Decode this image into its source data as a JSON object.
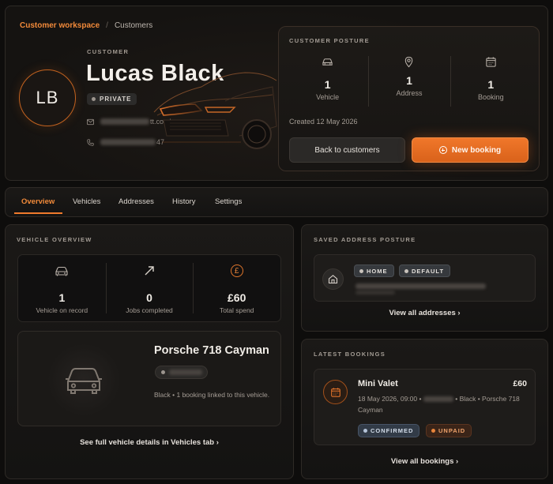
{
  "breadcrumb": {
    "workspace": "Customer workspace",
    "separator": "/",
    "current": "Customers"
  },
  "customer": {
    "section_label": "CUSTOMER",
    "initials": "LB",
    "name": "Lucas Black",
    "privacy_badge": "PRIVATE",
    "email_suffix": "tt.co.uk",
    "phone_suffix": "47"
  },
  "posture": {
    "title": "CUSTOMER POSTURE",
    "stats": [
      {
        "icon": "car-icon",
        "value": "1",
        "label": "Vehicle"
      },
      {
        "icon": "location-pin-icon",
        "value": "1",
        "label": "Address"
      },
      {
        "icon": "calendar-icon",
        "value": "1",
        "label": "Booking"
      }
    ],
    "created": "Created 12 May 2026",
    "back_button": "Back to customers",
    "new_booking_button": "New booking"
  },
  "tabs": [
    "Overview",
    "Vehicles",
    "Addresses",
    "History",
    "Settings"
  ],
  "active_tab": "Overview",
  "vehicle_overview": {
    "title": "VEHICLE OVERVIEW",
    "stats": [
      {
        "icon": "car-icon",
        "value": "1",
        "label": "Vehicle on record"
      },
      {
        "icon": "arrow-up-right-icon",
        "value": "0",
        "label": "Jobs completed"
      },
      {
        "icon": "pound-icon",
        "value": "£60",
        "label": "Total spend"
      }
    ],
    "vehicle": {
      "name": "Porsche 718 Cayman",
      "description": "Black • 1 booking linked to this vehicle."
    },
    "link": "See full vehicle details in Vehicles tab ›"
  },
  "saved_address": {
    "title": "SAVED ADDRESS POSTURE",
    "tags": [
      "HOME",
      "DEFAULT"
    ],
    "link": "View all addresses ›"
  },
  "latest_bookings": {
    "title": "LATEST BOOKINGS",
    "booking": {
      "service": "Mini Valet",
      "price": "£60",
      "date_time": "18 May 2026, 09:00 •",
      "vehicle": "• Black • Porsche 718 Cayman",
      "status": "CONFIRMED",
      "payment": "UNPAID"
    },
    "link": "View all bookings ›"
  },
  "colors": {
    "accent": "#f07a2c",
    "background": "#0e0d0c",
    "panel": "#181614"
  }
}
